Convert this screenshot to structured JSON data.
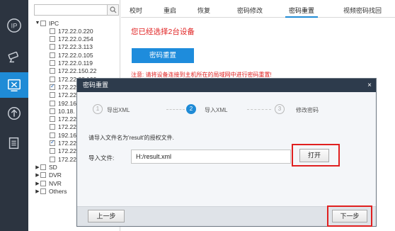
{
  "rail": {
    "items": [
      {
        "icon": "ip-logo-icon",
        "active": false
      },
      {
        "icon": "camera-icon",
        "active": false
      },
      {
        "icon": "tools-icon",
        "active": true
      },
      {
        "icon": "upgrade-icon",
        "active": false
      },
      {
        "icon": "document-icon",
        "active": false
      }
    ]
  },
  "tree": {
    "search_value": "",
    "root_label": "IPC",
    "ipc_items": [
      {
        "label": "172.22.0.220",
        "checked": false
      },
      {
        "label": "172.22.0.254",
        "checked": false
      },
      {
        "label": "172.22.3.113",
        "checked": false
      },
      {
        "label": "172.22.0.105",
        "checked": false
      },
      {
        "label": "172.22.0.119",
        "checked": false
      },
      {
        "label": "172.22.150.22",
        "checked": false
      },
      {
        "label": "172.22.88.100",
        "checked": false
      },
      {
        "label": "172.22",
        "checked": true
      },
      {
        "label": "172.22",
        "checked": false
      },
      {
        "label": "192.16",
        "checked": false
      },
      {
        "label": "10.18.",
        "checked": false
      },
      {
        "label": "172.22",
        "checked": false
      },
      {
        "label": "172.22",
        "checked": false
      },
      {
        "label": "192.16",
        "checked": false
      },
      {
        "label": "172.22",
        "checked": true
      },
      {
        "label": "172.22",
        "checked": false
      },
      {
        "label": "172.22",
        "checked": false
      }
    ],
    "groups": [
      "SD",
      "DVR",
      "NVR",
      "Others"
    ]
  },
  "tabs": [
    "校时",
    "重启",
    "恢复",
    "密码修改",
    "密码重置",
    "视频密码找回"
  ],
  "active_tab_index": 4,
  "main": {
    "selected_msg": "您已经选择2台设备",
    "reset_button": "密码重置",
    "notice": "注意: 请将设备连接到主机所在的局域网中进行密码重置!"
  },
  "dialog": {
    "title": "密码重置",
    "close": "×",
    "steps": [
      {
        "num": "1",
        "label": "导出XML",
        "active": false
      },
      {
        "num": "2",
        "label": "导入XML",
        "active": true
      },
      {
        "num": "3",
        "label": "修改密码",
        "active": false
      }
    ],
    "instruction": "请导入文件名为'result'的授权文件.",
    "file_label": "导入文件:",
    "file_value": "H:/result.xml",
    "open_button": "打开",
    "prev_button": "上一步",
    "next_button": "下一步"
  },
  "colors": {
    "accent": "#1f8bd6",
    "alert": "#e02020",
    "rail_bg": "#2c3440",
    "dialog_title_bg": "#2d3b4c"
  }
}
